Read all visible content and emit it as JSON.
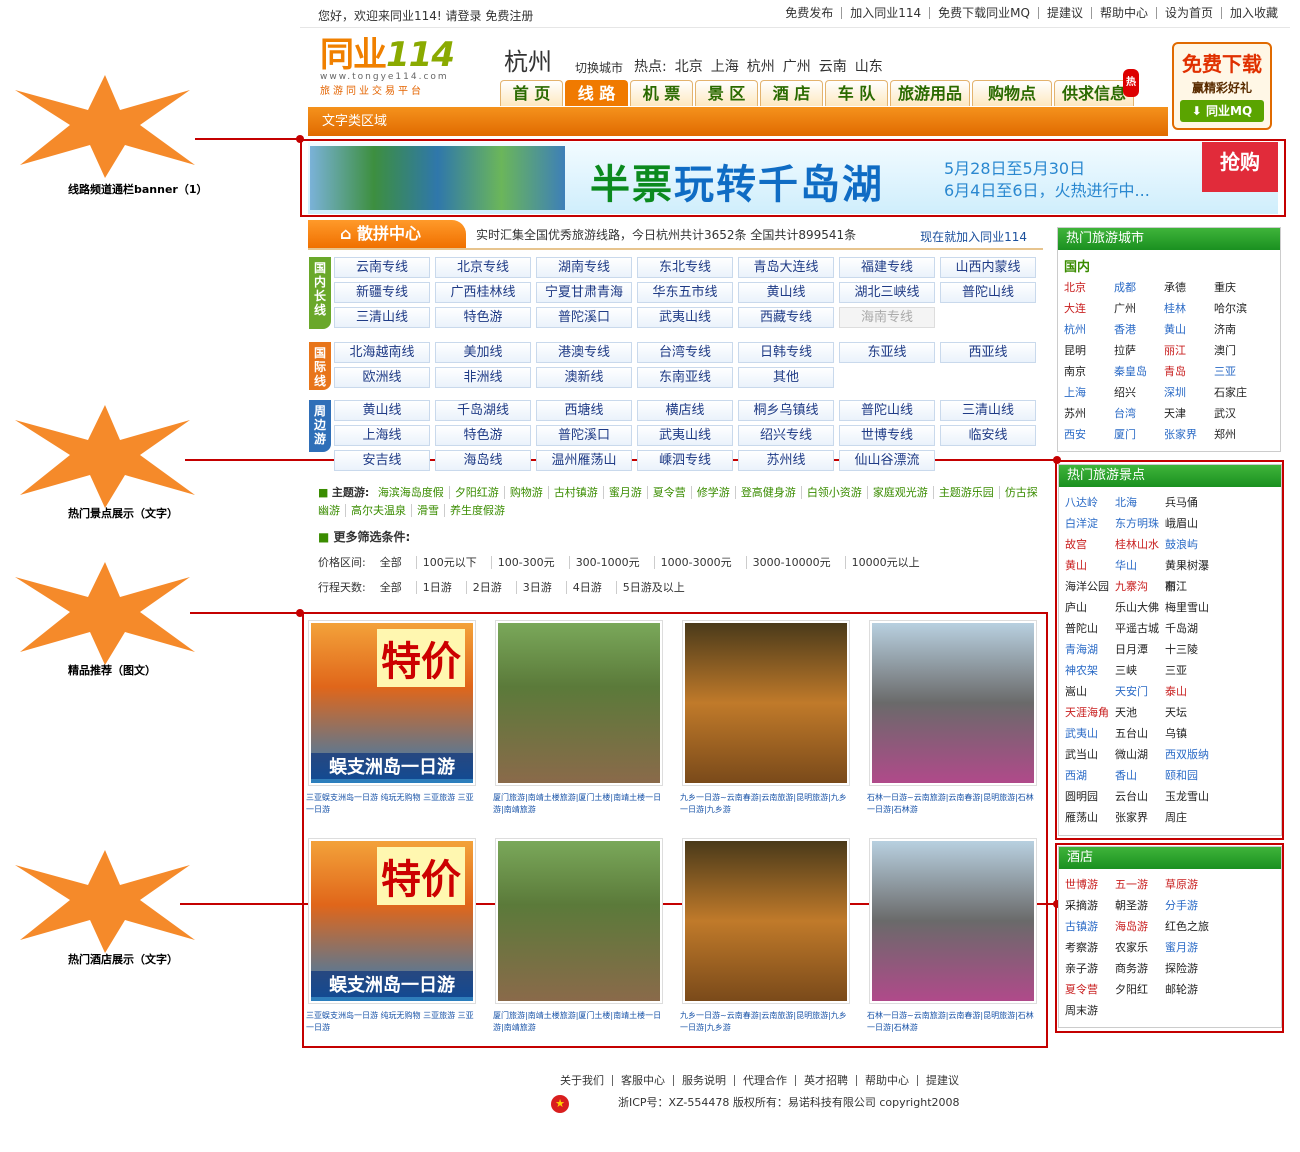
{
  "topbar": {
    "welcome": "您好，欢迎来同业114! 请登录  免费注册",
    "links": [
      "免费发布",
      "加入同业114",
      "免费下载同业MQ",
      "提建议",
      "帮助中心",
      "设为首页",
      "加入收藏"
    ]
  },
  "logo": {
    "name": "同业",
    "num": "114",
    "url": "www.tongye114.com",
    "slogan": "旅游同业交易平台"
  },
  "city": "杭州",
  "switch_city": "切换城市",
  "hot_label": "热点:",
  "hot_cities": [
    "北京",
    "上海",
    "杭州",
    "广州",
    "云南",
    "山东"
  ],
  "nav": [
    "首 页",
    "线 路",
    "机 票",
    "景 区",
    "酒 店",
    "车 队",
    "旅游用品",
    "购物点",
    "供求信息"
  ],
  "nav_badge": "热",
  "orange_bar": "文字类区域",
  "download": {
    "t1": "免费下载",
    "t2": "赢精彩好礼",
    "t3": "同业MQ"
  },
  "banner": {
    "title_a": "半票",
    "title_b": "玩转千岛湖",
    "date1": "5月28日至5月30日",
    "date2": "6月4日至6日，火热进行中...",
    "tag": "抢购"
  },
  "annotations": [
    "线路频道通栏banner（1）",
    "热门景点展示（文字）",
    "精品推荐（图文）",
    "热门酒店展示（文字）"
  ],
  "sanpin": {
    "title": "散拼中心",
    "desc": "实时汇集全国优秀旅游线路，今日杭州共计3652条  全国共计899541条",
    "join": "现在就加入同业114"
  },
  "groups": [
    {
      "label": "国内长线",
      "color": "#6aa82a",
      "items": [
        "云南专线",
        "北京专线",
        "湖南专线",
        "东北专线",
        "青岛大连线",
        "福建专线",
        "山西内蒙线",
        "新疆专线",
        "广西桂林线",
        "宁夏甘肃青海",
        "华东五市线",
        "黄山线",
        "湖北三峡线",
        "普陀山线",
        "三清山线",
        "特色游",
        "普陀溪口",
        "武夷山线",
        "西藏专线",
        "海南专线"
      ]
    },
    {
      "label": "国际线",
      "color": "#e8751a",
      "items": [
        "北海越南线",
        "美加线",
        "港澳专线",
        "台湾专线",
        "日韩专线",
        "东亚线",
        "西亚线",
        "欧洲线",
        "非洲线",
        "澳新线",
        "东南亚线",
        "其他"
      ]
    },
    {
      "label": "周边游",
      "color": "#2f6fb8",
      "items": [
        "黄山线",
        "千岛湖线",
        "西塘线",
        "横店线",
        "桐乡乌镇线",
        "普陀山线",
        "三清山线",
        "上海线",
        "特色游",
        "普陀溪口",
        "武夷山线",
        "绍兴专线",
        "世博专线",
        "临安线",
        "安吉线",
        "海岛线",
        "温州雁荡山",
        "嵊泗专线",
        "苏州线",
        "仙山谷漂流"
      ]
    }
  ],
  "theme": {
    "label": "主题游:",
    "items": [
      "海滨海岛度假",
      "夕阳红游",
      "购物游",
      "古村镇游",
      "蜜月游",
      "夏令营",
      "修学游",
      "登高健身游",
      "白领小资游",
      "家庭观光游",
      "主题游乐园",
      "仿古探幽游",
      "高尔夫温泉",
      "滑雪",
      "养生度假游"
    ]
  },
  "more": "更多筛选条件:",
  "price": {
    "label": "价格区间:",
    "items": [
      "全部",
      "100元以下",
      "100-300元",
      "300-1000元",
      "1000-3000元",
      "3000-10000元",
      "10000元以上"
    ]
  },
  "days": {
    "label": "行程天数:",
    "items": [
      "全部",
      "1日游",
      "2日游",
      "3日游",
      "4日游",
      "5日游及以上"
    ]
  },
  "products": [
    {
      "img": "特价",
      "img_sub": "蜈支洲岛一日游",
      "cap": "三亚蜈支洲岛一日游  纯玩无购物  三亚旅游  三亚一日游"
    },
    {
      "img": "",
      "img_sub": "",
      "cap": "厦门旅游|南靖土楼旅游|厦门土楼|南靖土楼一日游|南靖旅游"
    },
    {
      "img": "",
      "img_sub": "",
      "cap": "九乡一日游~云南春游|云南旅游|昆明旅游|九乡一日游|九乡游"
    },
    {
      "img": "",
      "img_sub": "",
      "cap": "石林一日游~云南旅游|云南春游|昆明旅游|石林一日游|石林游"
    }
  ],
  "hot_cities_box": {
    "title": "热门旅游城市",
    "sub": "国内",
    "items": [
      [
        "北京",
        "r"
      ],
      [
        "成都",
        "b"
      ],
      [
        "承德",
        "k"
      ],
      [
        "重庆",
        "k"
      ],
      [
        "大连",
        "r"
      ],
      [
        "广州",
        "k"
      ],
      [
        "桂林",
        "b"
      ],
      [
        "哈尔滨",
        "k"
      ],
      [
        "杭州",
        "b"
      ],
      [
        "香港",
        "b"
      ],
      [
        "黄山",
        "b"
      ],
      [
        "济南",
        "k"
      ],
      [
        "昆明",
        "k"
      ],
      [
        "拉萨",
        "k"
      ],
      [
        "丽江",
        "r"
      ],
      [
        "澳门",
        "k"
      ],
      [
        "南京",
        "k"
      ],
      [
        "秦皇岛",
        "b"
      ],
      [
        "青岛",
        "r"
      ],
      [
        "三亚",
        "b"
      ],
      [
        "上海",
        "b"
      ],
      [
        "绍兴",
        "k"
      ],
      [
        "深圳",
        "b"
      ],
      [
        "石家庄",
        "k"
      ],
      [
        "苏州",
        "k"
      ],
      [
        "台湾",
        "b"
      ],
      [
        "天津",
        "k"
      ],
      [
        "武汉",
        "k"
      ],
      [
        "西安",
        "b"
      ],
      [
        "厦门",
        "b"
      ],
      [
        "张家界",
        "b"
      ],
      [
        "郑州",
        "k"
      ]
    ]
  },
  "hot_spots_box": {
    "title": "热门旅游景点",
    "items": [
      [
        "八达岭",
        "b"
      ],
      [
        "北海",
        "b"
      ],
      [
        "兵马俑",
        "k"
      ],
      [
        "白洋淀",
        "b"
      ],
      [
        "东方明珠",
        "b"
      ],
      [
        "峨眉山",
        "k"
      ],
      [
        "故宫",
        "r"
      ],
      [
        "桂林山水",
        "r"
      ],
      [
        "鼓浪屿",
        "b"
      ],
      [
        "黄山",
        "r"
      ],
      [
        "华山",
        "b"
      ],
      [
        "黄果树瀑布",
        "k"
      ],
      [
        "海洋公园",
        "k"
      ],
      [
        "九寨沟",
        "r"
      ],
      [
        "丽江",
        "k"
      ],
      [
        "庐山",
        "k"
      ],
      [
        "乐山大佛",
        "k"
      ],
      [
        "梅里雪山",
        "k"
      ],
      [
        "普陀山",
        "k"
      ],
      [
        "平遥古城",
        "k"
      ],
      [
        "千岛湖",
        "k"
      ],
      [
        "青海湖",
        "b"
      ],
      [
        "日月潭",
        "k"
      ],
      [
        "十三陵",
        "k"
      ],
      [
        "神农架",
        "b"
      ],
      [
        "三峡",
        "k"
      ],
      [
        "三亚",
        "k"
      ],
      [
        "嵩山",
        "k"
      ],
      [
        "天安门",
        "b"
      ],
      [
        "泰山",
        "r"
      ],
      [
        "天涯海角",
        "r"
      ],
      [
        "天池",
        "k"
      ],
      [
        "天坛",
        "k"
      ],
      [
        "武夷山",
        "b"
      ],
      [
        "五台山",
        "k"
      ],
      [
        "乌镇",
        "k"
      ],
      [
        "武当山",
        "k"
      ],
      [
        "微山湖",
        "k"
      ],
      [
        "西双版纳",
        "b"
      ],
      [
        "西湖",
        "b"
      ],
      [
        "香山",
        "b"
      ],
      [
        "颐和园",
        "b"
      ],
      [
        "圆明园",
        "k"
      ],
      [
        "云台山",
        "k"
      ],
      [
        "玉龙雪山",
        "k"
      ],
      [
        "雁荡山",
        "k"
      ],
      [
        "张家界",
        "k"
      ],
      [
        "周庄",
        "k"
      ]
    ]
  },
  "hotel_box": {
    "title": "酒店",
    "items": [
      [
        "世博游",
        "r"
      ],
      [
        "五一游",
        "r"
      ],
      [
        "草原游",
        "r"
      ],
      [
        "采摘游",
        "k"
      ],
      [
        "朝圣游",
        "k"
      ],
      [
        "分手游",
        "b"
      ],
      [
        "古镇游",
        "b"
      ],
      [
        "海岛游",
        "r"
      ],
      [
        "红色之旅",
        "k"
      ],
      [
        "考察游",
        "k"
      ],
      [
        "农家乐",
        "k"
      ],
      [
        "蜜月游",
        "b"
      ],
      [
        "亲子游",
        "k"
      ],
      [
        "商务游",
        "k"
      ],
      [
        "探险游",
        "k"
      ],
      [
        "夏令营",
        "r"
      ],
      [
        "夕阳红",
        "k"
      ],
      [
        "邮轮游",
        "k"
      ],
      [
        "周末游",
        "k"
      ]
    ]
  },
  "footer": {
    "links": [
      "关于我们",
      "客服中心",
      "服务说明",
      "代理合作",
      "英才招聘",
      "帮助中心",
      "提建议"
    ],
    "copy": "浙ICP号：XZ-554478  版权所有：易诺科技有限公司  copyright2008"
  }
}
